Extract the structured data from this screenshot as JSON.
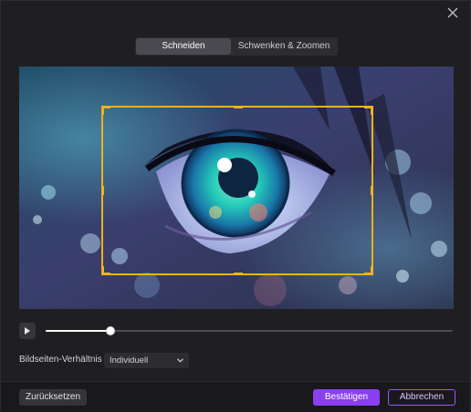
{
  "tabs": {
    "crop": "Schneiden",
    "pan_zoom": "Schwenken & Zoomen",
    "active": "crop"
  },
  "preview": {
    "image_description_icon": "anime-eye-image"
  },
  "playback": {
    "progress": 0.16
  },
  "aspect": {
    "label": "Bildseiten-Verhältnis",
    "selected": "Individuell"
  },
  "footer": {
    "reset_label": "Zurücksetzen",
    "confirm_label": "Bestätigen",
    "cancel_label": "Abbrechen"
  },
  "colors": {
    "accent": "#8a3ff0",
    "crop_frame": "#f0b21a"
  }
}
